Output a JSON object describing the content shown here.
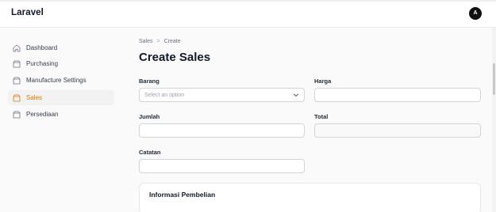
{
  "app": {
    "title": "Laravel",
    "avatar_initial": "A"
  },
  "sidebar": {
    "items": [
      {
        "label": "Dashboard",
        "icon": "home-icon",
        "active": false
      },
      {
        "label": "Purchasing",
        "icon": "box-icon",
        "active": false
      },
      {
        "label": "Manufacture Settings",
        "icon": "box-icon",
        "active": false
      },
      {
        "label": "Sales",
        "icon": "box-icon",
        "active": true
      },
      {
        "label": "Persediaan",
        "icon": "box-icon",
        "active": false
      }
    ]
  },
  "breadcrumb": {
    "parent": "Sales",
    "separator": ">",
    "current": "Create"
  },
  "page": {
    "title": "Create Sales"
  },
  "form": {
    "barang": {
      "label": "Barang",
      "placeholder": "Select an option",
      "value": ""
    },
    "harga": {
      "label": "Harga",
      "value": ""
    },
    "jumlah": {
      "label": "Jumlah",
      "value": ""
    },
    "total": {
      "label": "Total",
      "value": ""
    },
    "catatan": {
      "label": "Catatan",
      "value": ""
    }
  },
  "section": {
    "title": "Informasi Pembelian"
  },
  "colors": {
    "accent": "#d97706",
    "active_bg": "#f2f2f2",
    "border": "#d1d5db"
  }
}
